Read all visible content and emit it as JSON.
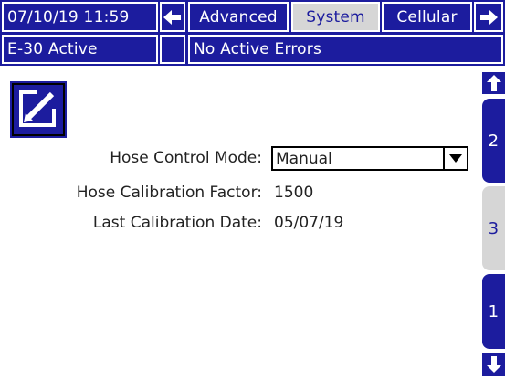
{
  "header": {
    "datetime": "07/10/19 11:59",
    "tabs": [
      {
        "label": "Advanced",
        "active": false
      },
      {
        "label": "System",
        "active": true
      },
      {
        "label": "Cellular",
        "active": false
      }
    ],
    "left_arrow_icon": "arrow-left-icon",
    "right_arrow_icon": "arrow-right-icon"
  },
  "status": {
    "mode": "E-30 Active",
    "errors": "No Active Errors"
  },
  "main": {
    "edit_icon": "edit-pencil-icon",
    "fields": {
      "control_mode_label": "Hose Control Mode:",
      "control_mode_value": "Manual",
      "calibration_factor_label": "Hose Calibration Factor:",
      "calibration_factor_value": "1500",
      "calibration_date_label": "Last Calibration Date:",
      "calibration_date_value": "05/07/19"
    }
  },
  "pager": {
    "up_icon": "arrow-up-icon",
    "down_icon": "arrow-down-icon",
    "pages": [
      {
        "label": "2",
        "active": false
      },
      {
        "label": "3",
        "active": true
      },
      {
        "label": "1",
        "active": false
      }
    ]
  },
  "colors": {
    "primary": "#1c1c9e",
    "active_tab": "#d6d6d6",
    "background": "#ffffff"
  }
}
